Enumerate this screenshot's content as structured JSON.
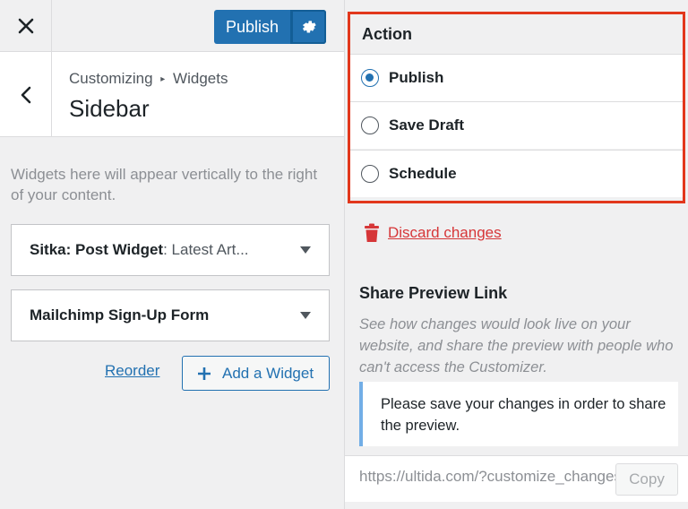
{
  "topbar": {
    "close_icon": "close-icon",
    "publish_label": "Publish",
    "gear_icon": "gear-icon"
  },
  "section": {
    "breadcrumb_parent": "Customizing",
    "breadcrumb_arrow": "▸",
    "breadcrumb_child": "Widgets",
    "title": "Sidebar",
    "back_icon": "chevron-left-icon"
  },
  "description": "Widgets here will appear vertically to the right of your content.",
  "widgets": [
    {
      "name": "Sitka: Post Widget",
      "sub": ": Latest Art..."
    },
    {
      "name": "Mailchimp Sign-Up Form",
      "sub": ""
    }
  ],
  "reorder_label": "Reorder",
  "add_widget_label": "Add a Widget",
  "action": {
    "title": "Action",
    "options": [
      {
        "label": "Publish",
        "checked": true
      },
      {
        "label": "Save Draft",
        "checked": false
      },
      {
        "label": "Schedule",
        "checked": false
      }
    ]
  },
  "discard_label": "Discard changes",
  "share": {
    "title": "Share Preview Link",
    "description": "See how changes would look live on your website, and share the preview with people who can't access the Customizer.",
    "notice": "Please save your changes in order to share the preview.",
    "url": "https://ultida.com/?customize_changeset_uuid",
    "copy_label": "Copy"
  },
  "colors": {
    "accent": "#2271b1",
    "danger": "#d63638",
    "highlight_border": "#e2371c"
  }
}
